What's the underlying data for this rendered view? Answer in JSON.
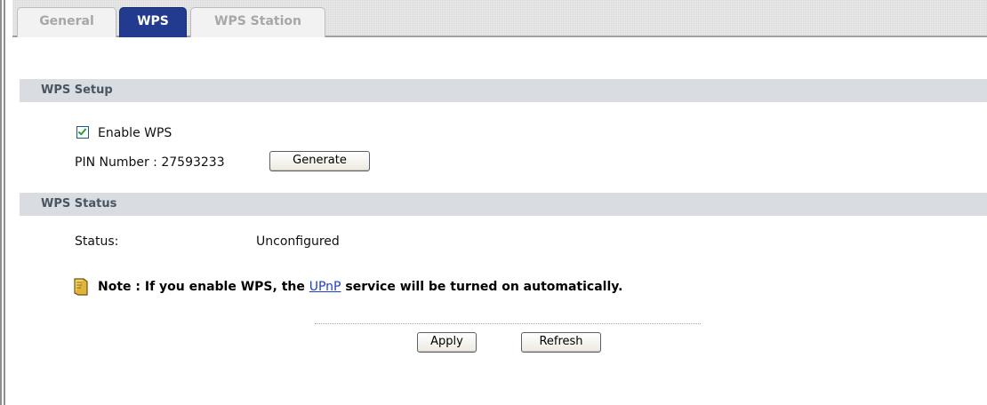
{
  "tabs": [
    {
      "label": "General",
      "active": false
    },
    {
      "label": "WPS",
      "active": true
    },
    {
      "label": "WPS Station",
      "active": false
    }
  ],
  "wps_setup": {
    "title": "WPS Setup",
    "enable_label": "Enable WPS",
    "enable_checked": true,
    "pin_label": "PIN Number : 27593233",
    "generate_label": "Generate"
  },
  "wps_status": {
    "title": "WPS Status",
    "status_label": "Status:",
    "status_value": "Unconfigured"
  },
  "note": {
    "prefix": "Note : If you enable WPS, the",
    "link": "UPnP",
    "suffix": "service will be turned on automatically."
  },
  "actions": {
    "apply_label": "Apply",
    "refresh_label": "Refresh"
  },
  "colors": {
    "active_tab": "#233b8f",
    "section_bar": "#d9dde1",
    "section_text": "#4a5561",
    "link": "#1a3fd0"
  }
}
